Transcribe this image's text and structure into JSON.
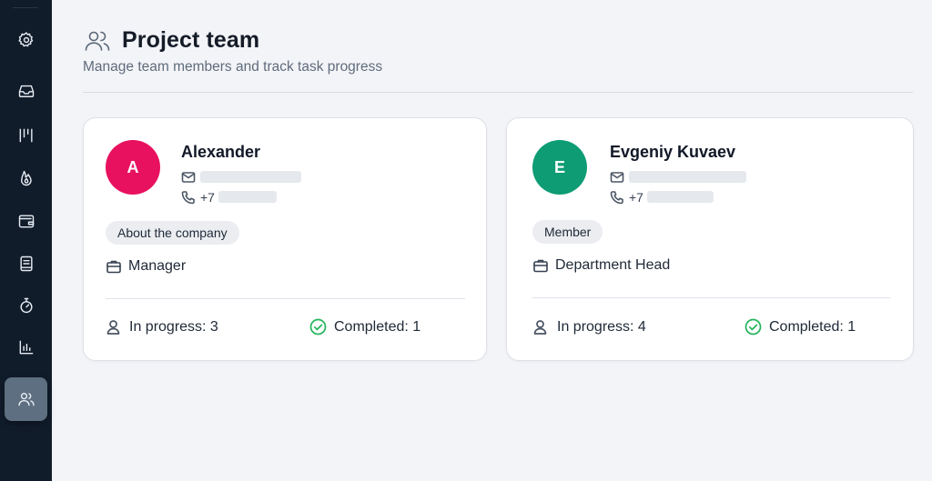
{
  "sidebar": {
    "items": [
      {
        "icon": "gear-icon"
      },
      {
        "icon": "inbox-icon"
      },
      {
        "icon": "columns-icon"
      },
      {
        "icon": "flame-icon"
      },
      {
        "icon": "wallet-icon"
      },
      {
        "icon": "book-icon"
      },
      {
        "icon": "stopwatch-icon"
      },
      {
        "icon": "bar-chart-icon"
      },
      {
        "icon": "users-icon",
        "active": true
      }
    ]
  },
  "header": {
    "icon": "users-icon",
    "title": "Project team",
    "subtitle": "Manage team members and track task progress"
  },
  "members": [
    {
      "initial": "A",
      "avatar_color": "#e8115f",
      "name": "Alexander",
      "phone_prefix": "+7",
      "badge": "About the company",
      "role": "Manager",
      "in_progress": "In progress: 3",
      "completed": "Completed: 1"
    },
    {
      "initial": "E",
      "avatar_color": "#0e9c74",
      "name": "Evgeniy Kuvaev",
      "phone_prefix": "+7",
      "badge": "Member",
      "role": "Department Head",
      "in_progress": "In progress: 4",
      "completed": "Completed: 1"
    }
  ],
  "colors": {
    "sidebar_bg": "#111c2b",
    "completed_green": "#22b45a"
  }
}
